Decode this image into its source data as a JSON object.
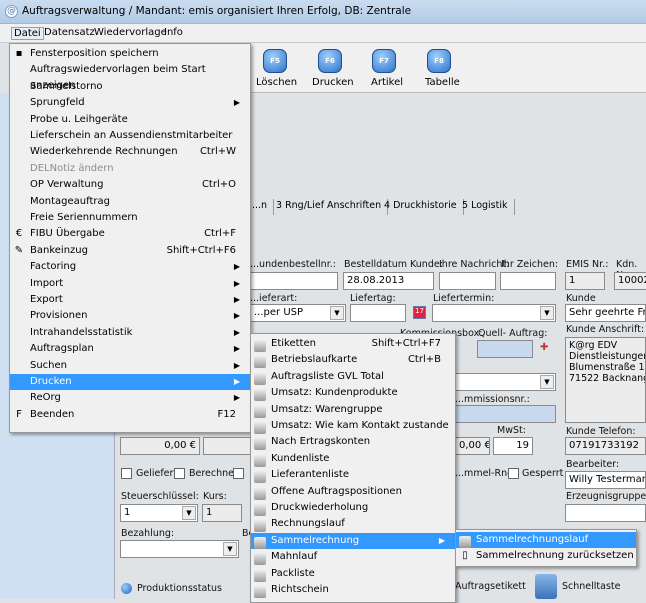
{
  "window": {
    "title": "Auftragsverwaltung / Mandant: emis organisiert Ihren Erfolg, DB: Zentrale"
  },
  "menubar": [
    "Datei",
    "Datensatz",
    "Wiedervorlage",
    "Info"
  ],
  "toolbar": [
    {
      "key": "F5",
      "label": "Löschen"
    },
    {
      "key": "F6",
      "label": "Drucken"
    },
    {
      "key": "F7",
      "label": "Artikel"
    },
    {
      "key": "F8",
      "label": "Tabelle"
    }
  ],
  "tabs": [
    "...n",
    "3 Rng/Lief Anschriften",
    "4 Druckhistorie",
    "5 Logistik"
  ],
  "form": {
    "kundenbestellnr_label": "...undenbestellnr.:",
    "bestelldatum_label": "Bestelldatum Kunde:",
    "bestelldatum": "28.08.2013",
    "ihre_nachricht_label": "Ihre Nachricht:",
    "ihr_zeichen_label": "Ihr Zeichen:",
    "emis_nr_label": "EMIS Nr.:",
    "emis_nr": "1",
    "kdn_nr_label": "Kdn. Nr",
    "kdn_nr": "10002",
    "lieferart_label": "...ieferart:",
    "lieferart": "...per USP",
    "liefertag_label": "Liefertag:",
    "liefertermin_label": "Liefertermin:",
    "ansprechpartner_label": "Kunde Ansprechpart...",
    "ansprechpartner": "Sehr geehrte Frau B...",
    "kommissionsbox_label": "Kommissionsbox:",
    "quell_auftrag_label": "Quell- Auftrag:",
    "anschrift_label": "Kunde Anschrift:",
    "anschrift": [
      "K@rg EDV",
      "Dienstleistungen Gm...",
      "Blumenstraße 11",
      "71522 Backnang"
    ],
    "kommissionsnr_label": "...mmissionsnr.:",
    "betrag1": "0,00 €",
    "betrag2": "0,00 €",
    "mwst_label": "MwSt:",
    "mwst": "19",
    "telefon_label": "Kunde Telefon:",
    "telefon": "07191733192",
    "geliefert": "Geliefert",
    "berechnet": "Berechnet",
    "sammel_rng": "...mmel-Rng.",
    "gesperrt": "Gesperrt",
    "bearbeiter_label": "Bearbeiter:",
    "bearbeiter": "Willy Testermann",
    "steuerschluessel_label": "Steuerschlüssel:",
    "steuerschluessel": "1",
    "kurs_label": "Kurs:",
    "kurs": "1",
    "erzeugnisgruppe_label": "Erzeugnisgruppe:",
    "bezahlung_label": "Bezahlung:",
    "be_label": "Be...",
    "produktionsstatus": "Produktionsstatus",
    "auftragsetikett": "Auftragsetikett",
    "schnelltaste": "Schnelltaste"
  },
  "datei_menu": [
    {
      "label": "Fensterposition speichern",
      "icon": "save-icon"
    },
    {
      "label": "Auftragswiedervorlagen beim Start anzeigen"
    },
    {
      "label": "Sammelstorno"
    },
    {
      "label": "Sprungfeld",
      "submenu": true
    },
    {
      "label": "Probe u. Leihgeräte"
    },
    {
      "label": "Lieferschein an Aussendienstmitarbeiter"
    },
    {
      "label": "Wiederkehrende Rechnungen",
      "shortcut": "Ctrl+W"
    },
    {
      "label": "DELNotiz ändern",
      "disabled": true
    },
    {
      "label": "OP Verwaltung",
      "shortcut": "Ctrl+O"
    },
    {
      "label": "Montageauftrag"
    },
    {
      "label": "Freie Seriennummern"
    },
    {
      "label": "FIBU Übergabe",
      "shortcut": "Ctrl+F",
      "icon": "euro-icon"
    },
    {
      "label": "Bankeinzug",
      "shortcut": "Shift+Ctrl+F6",
      "icon": "card-icon"
    },
    {
      "label": "Factoring",
      "submenu": true
    },
    {
      "label": "Import",
      "submenu": true
    },
    {
      "label": "Export",
      "submenu": true
    },
    {
      "label": "Provisionen",
      "submenu": true
    },
    {
      "label": "Intrahandelsstatistik",
      "submenu": true
    },
    {
      "label": "Auftragsplan",
      "submenu": true
    },
    {
      "label": "Suchen",
      "submenu": true
    },
    {
      "label": "Drucken",
      "submenu": true,
      "selected": true
    },
    {
      "label": "ReOrg",
      "submenu": true
    },
    {
      "label": "Beenden",
      "shortcut": "F12",
      "icon": "exit-icon"
    }
  ],
  "drucken_menu": [
    {
      "label": "Etiketten",
      "shortcut": "Shift+Ctrl+F7"
    },
    {
      "label": "Betriebslaufkarte",
      "shortcut": "Ctrl+B"
    },
    {
      "label": "Auftragsliste GVL Total"
    },
    {
      "label": "Umsatz: Kundenprodukte"
    },
    {
      "label": "Umsatz: Warengruppe"
    },
    {
      "label": "Umsatz: Wie kam Kontakt zustande"
    },
    {
      "label": "Nach Ertragskonten"
    },
    {
      "label": "Kundenliste"
    },
    {
      "label": "Lieferantenliste"
    },
    {
      "label": "Offene Auftragspositionen"
    },
    {
      "label": "Druckwiederholung"
    },
    {
      "label": "Rechnungslauf"
    },
    {
      "label": "Sammelrechnung",
      "submenu": true,
      "selected": true
    },
    {
      "label": "Mahnlauf"
    },
    {
      "label": "Packliste"
    },
    {
      "label": "Richtschein"
    }
  ],
  "sammel_menu": [
    {
      "label": "Sammelrechnungslauf",
      "selected": true,
      "icon": "printer-icon"
    },
    {
      "label": "Sammelrechnung zurücksetzen",
      "icon": "document-icon"
    }
  ],
  "colors": {
    "highlight": "#3399ff",
    "menu_bg": "#f0f0f0"
  }
}
